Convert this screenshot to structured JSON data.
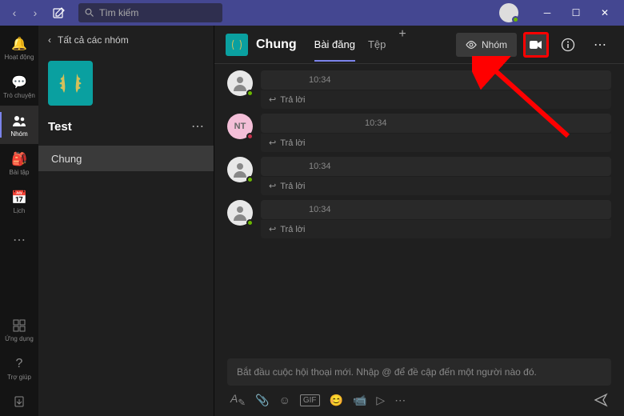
{
  "titlebar": {
    "search_placeholder": "Tìm kiếm"
  },
  "rail": {
    "items": [
      {
        "label": "Hoạt động"
      },
      {
        "label": "Trò chuyện"
      },
      {
        "label": "Nhóm"
      },
      {
        "label": "Bài tập"
      },
      {
        "label": "Lịch"
      }
    ],
    "apps_label": "Ứng dụng",
    "help_label": "Trợ giúp"
  },
  "sidebar": {
    "back_label": "Tất cả các nhóm",
    "team_name": "Test",
    "channel": "Chung"
  },
  "channel_header": {
    "title": "Chung",
    "tabs": [
      {
        "label": "Bài đăng"
      },
      {
        "label": "Tệp"
      }
    ],
    "team_btn": "Nhóm"
  },
  "posts": [
    {
      "avatar_bg": "#e8e8e8",
      "avatar_txt": "",
      "presence": "#6bb700",
      "time": "10:34",
      "reply": "Trả lời"
    },
    {
      "avatar_bg": "#f4bfd8",
      "avatar_txt": "NT",
      "presence": "#c4314b",
      "time": "10:34",
      "reply": "Trả lời"
    },
    {
      "avatar_bg": "#e8e8e8",
      "avatar_txt": "",
      "presence": "#6bb700",
      "time": "10:34",
      "reply": "Trả lời"
    },
    {
      "avatar_bg": "#e8e8e8",
      "avatar_txt": "",
      "presence": "#6bb700",
      "time": "10:34",
      "reply": "Trả lời"
    }
  ],
  "composer": {
    "placeholder": "Bắt đầu cuộc hội thoại mới. Nhập @ để đề cập đến một người nào đó."
  }
}
